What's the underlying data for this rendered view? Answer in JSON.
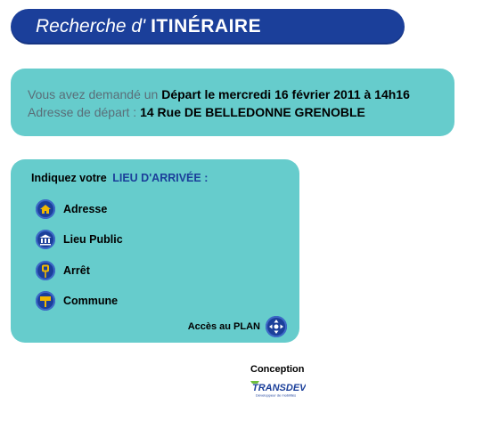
{
  "header": {
    "prefix": "Recherche d'",
    "title": "ITINÉRAIRE"
  },
  "request": {
    "line1_label": "Vous avez demandé un",
    "line1_value": "Départ le mercredi 16 février 2011 à 14h16",
    "line2_label": "Adresse de départ :",
    "line2_value": "14 Rue DE BELLEDONNE GRENOBLE"
  },
  "arrival": {
    "prompt": "Indiquez votre",
    "prompt_accent": "LIEU D'ARRIVÉE :",
    "options": [
      {
        "label": "Adresse",
        "icon": "house-icon"
      },
      {
        "label": "Lieu Public",
        "icon": "public-building-icon"
      },
      {
        "label": "Arrêt",
        "icon": "bus-stop-icon"
      },
      {
        "label": "Commune",
        "icon": "town-sign-icon"
      }
    ],
    "plan_label": "Accès au PLAN",
    "plan_icon": "map-navigation-icon"
  },
  "footer": {
    "conception_label": "Conception",
    "logo_text": "TRANSDEV",
    "logo_tagline": "Développeur de mobilités"
  },
  "colors": {
    "brand_blue": "#1b3f9a",
    "panel_teal": "#66cccc",
    "label_grey": "#5a6e78"
  }
}
